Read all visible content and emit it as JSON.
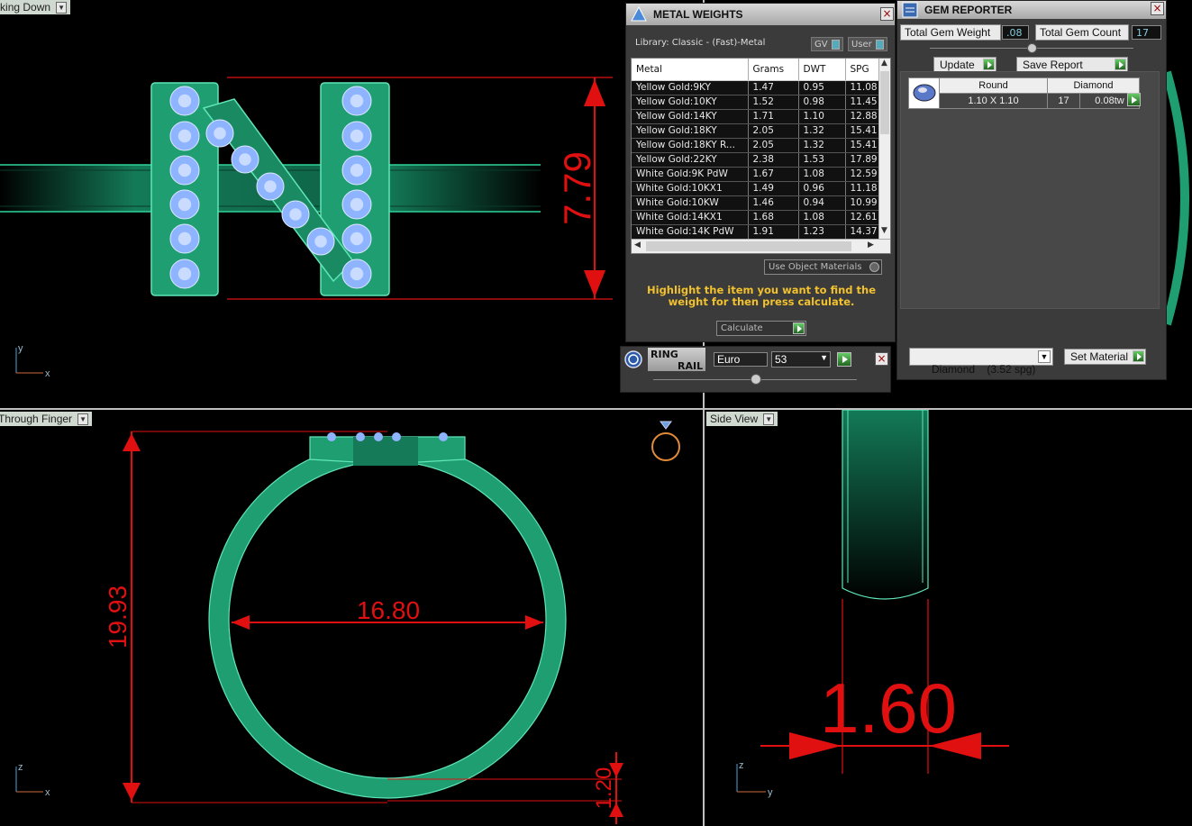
{
  "viewports": {
    "top_left": {
      "label": "Looking Down",
      "dimension": "7.79",
      "axis_a": "y",
      "axis_b": "x"
    },
    "bottom_left": {
      "label": "Through Finger",
      "dim_height": "19.93",
      "dim_inner": "16.80",
      "dim_thickness": "1.20",
      "axis_a": "z",
      "axis_b": "x"
    },
    "bottom_right": {
      "label": "Side View",
      "dimension": "1.60",
      "axis_a": "z",
      "axis_b": "y"
    }
  },
  "metal_weights": {
    "title": "METAL WEIGHTS",
    "library": "Library: Classic - (Fast)-Metal",
    "toggle_gv": "GV",
    "toggle_user": "User",
    "columns": [
      "Metal",
      "Grams",
      "DWT",
      "SPG"
    ],
    "rows": [
      [
        "Yellow Gold:9KY",
        "1.47",
        "0.95",
        "11.08"
      ],
      [
        "Yellow Gold:10KY",
        "1.52",
        "0.98",
        "11.45"
      ],
      [
        "Yellow Gold:14KY",
        "1.71",
        "1.10",
        "12.88"
      ],
      [
        "Yellow Gold:18KY",
        "2.05",
        "1.32",
        "15.41"
      ],
      [
        "Yellow Gold:18KY R...",
        "2.05",
        "1.32",
        "15.41"
      ],
      [
        "Yellow Gold:22KY",
        "2.38",
        "1.53",
        "17.89"
      ],
      [
        "White Gold:9K PdW",
        "1.67",
        "1.08",
        "12.59"
      ],
      [
        "White Gold:10KX1",
        "1.49",
        "0.96",
        "11.18"
      ],
      [
        "White Gold:10KW",
        "1.46",
        "0.94",
        "10.99"
      ],
      [
        "White Gold:14KX1",
        "1.68",
        "1.08",
        "12.61"
      ],
      [
        "White Gold:14K PdW",
        "1.91",
        "1.23",
        "14.37"
      ]
    ],
    "use_object_materials": "Use Object Materials",
    "hint": "Highlight the item you want to find the weight for then press calculate.",
    "calculate": "Calculate"
  },
  "ring_rail": {
    "title_line1": "RING",
    "title_line2": "RAIL",
    "standard": "Euro",
    "size": "53"
  },
  "gem_reporter": {
    "title": "GEM REPORTER",
    "total_weight_label": "Total Gem Weight",
    "total_weight_value": ".08",
    "total_count_label": "Total Gem Count",
    "total_count_value": "17",
    "update": "Update",
    "save_report": "Save Report",
    "gem_shape": "Round",
    "gem_material": "Diamond",
    "gem_size": "1.10 X 1.10",
    "gem_count": "17",
    "gem_weight": "0.08tw",
    "material_select": "Diamond    (3.52 spg)",
    "set_material": "Set Material"
  },
  "colors": {
    "model": "#1f9e72",
    "dimension": "#e01010",
    "stone": "#8fb4ff",
    "hint": "#f2c12e"
  }
}
